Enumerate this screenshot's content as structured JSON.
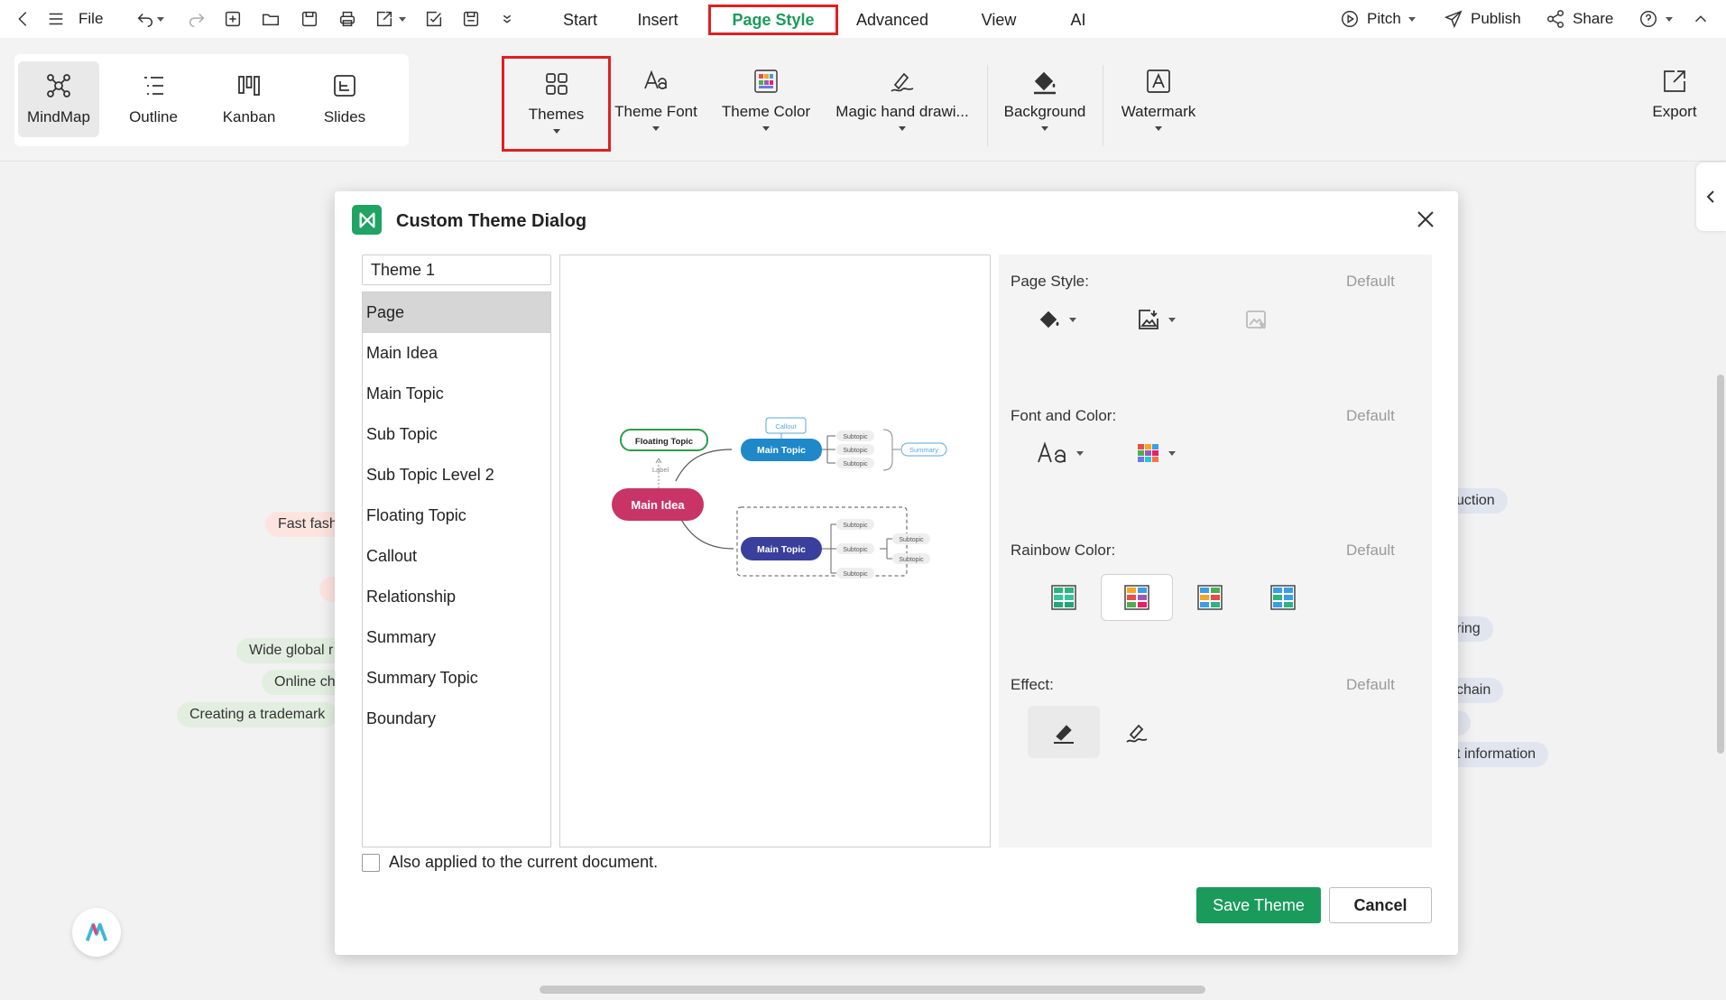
{
  "menubar": {
    "file_label": "File",
    "tabs": [
      {
        "label": "Start"
      },
      {
        "label": "Insert"
      },
      {
        "label": "Page Style"
      },
      {
        "label": "Advanced"
      },
      {
        "label": "View"
      },
      {
        "label": "AI"
      }
    ],
    "active_tab": "Page Style",
    "pitch_label": "Pitch",
    "publish_label": "Publish",
    "share_label": "Share"
  },
  "ribbon": {
    "views": [
      {
        "label": "MindMap",
        "icon": "mindmap-icon"
      },
      {
        "label": "Outline",
        "icon": "outline-icon"
      },
      {
        "label": "Kanban",
        "icon": "kanban-icon"
      },
      {
        "label": "Slides",
        "icon": "slides-icon"
      }
    ],
    "active_view": "MindMap",
    "buttons": [
      {
        "label": "Themes",
        "icon": "themes-icon"
      },
      {
        "label": "Theme Font",
        "icon": "theme-font-icon"
      },
      {
        "label": "Theme Color",
        "icon": "theme-color-icon"
      },
      {
        "label": "Magic hand drawi...",
        "icon": "magic-hand-drawing-icon"
      },
      {
        "label": "Background",
        "icon": "background-fill-icon"
      },
      {
        "label": "Watermark",
        "icon": "watermark-icon"
      },
      {
        "label": "Export",
        "icon": "export-icon"
      }
    ]
  },
  "canvas": {
    "left_nodes": [
      {
        "text": "Fast fash"
      },
      {
        "text": "Wide global r"
      },
      {
        "text": "Online ch"
      },
      {
        "text": "Creating a trademark"
      }
    ],
    "right_nodes": [
      {
        "text": "uction"
      },
      {
        "text": "ring"
      },
      {
        "text": "chain"
      },
      {
        "text": "t information"
      }
    ]
  },
  "dialog": {
    "title": "Custom Theme Dialog",
    "theme_name": "Theme 1",
    "categories": [
      "Page",
      "Main Idea",
      "Main Topic",
      "Sub Topic",
      "Sub Topic Level 2",
      "Floating Topic",
      "Callout",
      "Relationship",
      "Summary",
      "Summary Topic",
      "Boundary"
    ],
    "selected_category": "Page",
    "preview": {
      "main_idea": "Main Idea",
      "floating_topic": "Floating Topic",
      "label": "Label",
      "callout": "Callout",
      "main_topic_1": "Main Topic",
      "main_topic_2": "Main Topic",
      "subtopic": "Subtopic",
      "summary": "Summary",
      "colors": {
        "main_idea": "#c93466",
        "main_topic_1": "#1f88c9",
        "main_topic_2": "#3a3f9c",
        "floating_border": "#2e9b4a"
      }
    },
    "props": {
      "page_style_label": "Page Style:",
      "font_color_label": "Font and Color:",
      "rainbow_label": "Rainbow Color:",
      "effect_label": "Effect:",
      "default_label": "Default"
    },
    "apply_checkbox_label": "Also applied to the current document.",
    "save_label": "Save Theme",
    "cancel_label": "Cancel"
  }
}
